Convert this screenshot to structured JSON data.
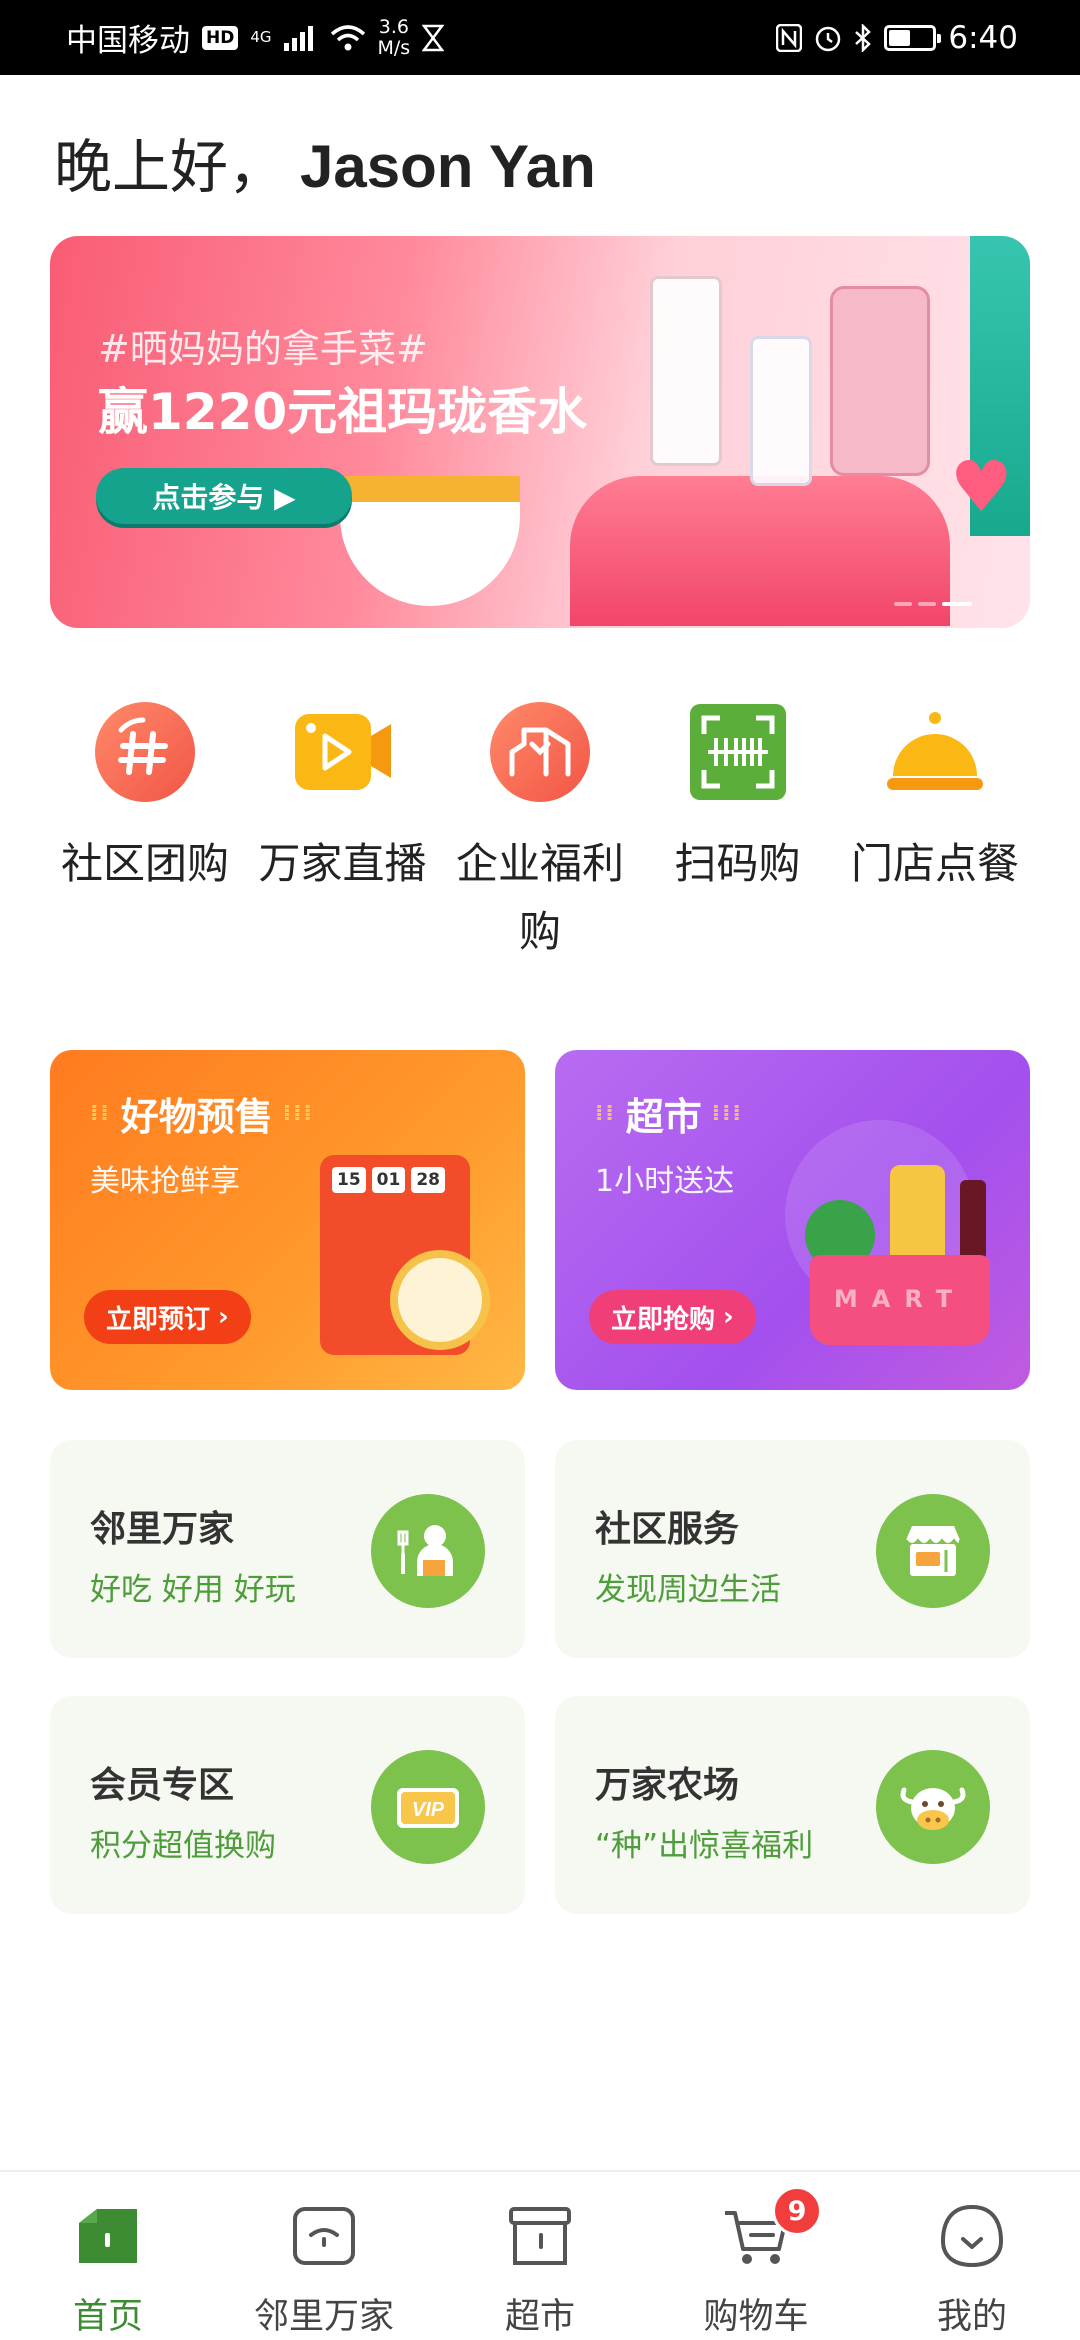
{
  "status_bar": {
    "carrier": "中国移动",
    "hd": "HD",
    "network": "4G",
    "speed_value": "3.6",
    "speed_unit": "M/s",
    "time": "6:40",
    "battery_level": 0.5
  },
  "greeting": {
    "salutation": "晚上好，",
    "name": "Jason Yan"
  },
  "banner": {
    "hashtag": "#晒妈妈的拿手菜#",
    "headline": "赢1220元祖玛珑香水",
    "cta": "点击参与 ▶"
  },
  "quick_actions": [
    {
      "label": "社区团购",
      "icon": "hash-icon",
      "color": "#f5654f"
    },
    {
      "label": "万家直播",
      "icon": "video-play-icon",
      "color": "#fbb714"
    },
    {
      "label": "企业福利购",
      "icon": "building-icon",
      "color": "#f5654f"
    },
    {
      "label": "扫码购",
      "icon": "scan-barcode-icon",
      "color": "#5cae3a"
    },
    {
      "label": "门店点餐",
      "icon": "food-cloche-icon",
      "color": "#fbb714"
    }
  ],
  "promos": {
    "presale": {
      "title": "好物预售",
      "subtitle": "美味抢鲜享",
      "button": "立即预订",
      "countdown": [
        "15",
        "01",
        "28"
      ]
    },
    "supermarket": {
      "title": "超市",
      "subtitle": "1小时送达",
      "button": "立即抢购",
      "basket_text": "MART"
    }
  },
  "services": [
    {
      "title": "邻里万家",
      "subtitle": "好吃 好用 好玩",
      "icon": "neighbor-person-icon"
    },
    {
      "title": "社区服务",
      "subtitle": "发现周边生活",
      "icon": "storefront-icon"
    },
    {
      "title": "会员专区",
      "subtitle": "积分超值换购",
      "icon": "vip-card-icon",
      "icon_text": "VIP"
    },
    {
      "title": "万家农场",
      "subtitle": "“种”出惊喜福利",
      "icon": "cow-face-icon"
    }
  ],
  "bottom_nav": [
    {
      "label": "首页",
      "icon": "home-icon",
      "active": true
    },
    {
      "label": "邻里万家",
      "icon": "neighbor-icon",
      "active": false
    },
    {
      "label": "超市",
      "icon": "store-icon",
      "active": false
    },
    {
      "label": "购物车",
      "icon": "cart-icon",
      "active": false,
      "badge": "9"
    },
    {
      "label": "我的",
      "icon": "profile-icon",
      "active": false
    }
  ],
  "colors": {
    "brand_green": "#3d8b32",
    "service_green": "#7cc24c",
    "badge_red": "#f23d3d"
  }
}
